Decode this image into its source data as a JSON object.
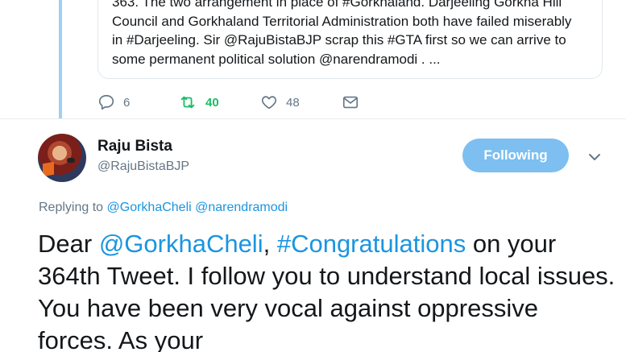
{
  "quoted": {
    "lines": [
      "363. The two arrangement in place of #Gorkhaland. Darjeeling Gorkha Hill",
      "Council and Gorkhaland Territorial Administration both have failed miserably",
      "in #Darjeeling. Sir @RajuBistaBJP scrap this #GTA first so we can arrive to",
      "some permanent political solution  @narendramodi . ..."
    ]
  },
  "actions": {
    "reply_count": "6",
    "retweet_count": "40",
    "like_count": "48"
  },
  "tweet": {
    "author_name": "Raju Bista",
    "author_handle": "@RajuBistaBJP",
    "follow_label": "Following",
    "replying_prefix": "Replying to ",
    "replying_mention_1": "@GorkhaCheli",
    "replying_mention_2": "@narendramodi",
    "text_1": "Dear ",
    "link_1": "@GorkhaCheli",
    "text_2": ", ",
    "link_2": "#Congratulations",
    "text_3": " on your 364th Tweet. I follow you to understand local issues. You have been very vocal against oppressive forces. As your"
  },
  "colors": {
    "accent": "#1b95e0",
    "retweet": "#17bf63",
    "button": "#7cbff0",
    "thread_line": "#9fd0f5"
  },
  "icons": [
    "reply-icon",
    "retweet-icon",
    "like-icon",
    "direct-message-icon",
    "chevron-down-icon"
  ]
}
